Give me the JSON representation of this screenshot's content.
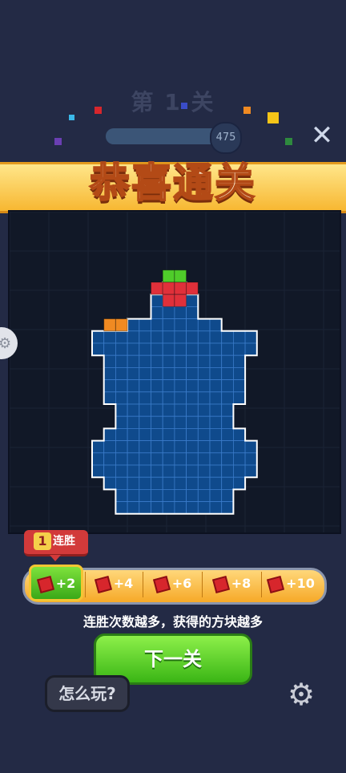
{
  "header": {
    "level_title": "第 1 关",
    "score": "475",
    "progress": 0.9,
    "close_icon": "close-icon"
  },
  "banner": {
    "text": "恭喜通关"
  },
  "streak": {
    "count": "1",
    "label": "连胜"
  },
  "rewards": [
    {
      "label": "+2",
      "active": true
    },
    {
      "label": "+4",
      "active": false
    },
    {
      "label": "+6",
      "active": false
    },
    {
      "label": "+8",
      "active": false
    },
    {
      "label": "+10",
      "active": false
    }
  ],
  "hint": "连胜次数越多，获得的方块越多",
  "buttons": {
    "next": "下一关",
    "howto": "怎么玩?",
    "settings_icon": "gear-icon"
  },
  "colors": {
    "board_fill": "#0f4a8c",
    "cell_line": "#3a7bc8",
    "outline": "#ffffff",
    "green": "#4fcc2a",
    "red": "#e0303a",
    "orange": "#f08a22"
  }
}
